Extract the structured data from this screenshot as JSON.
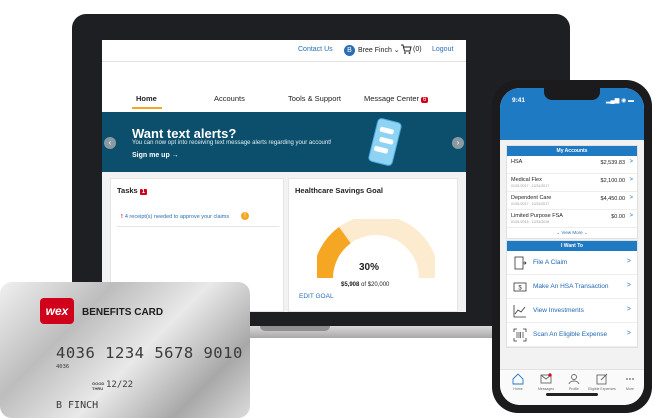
{
  "web": {
    "contact_label": "Contact Us",
    "user_initial": "B",
    "user_name": "Bree Finch ⌄",
    "cart_count": "(0)",
    "logout_label": "Logout",
    "nav": {
      "home": "Home",
      "accounts": "Accounts",
      "tools": "Tools & Support",
      "messages": "Message Center",
      "messages_badge": "6"
    },
    "banner": {
      "title": "Want text alerts?",
      "subtitle": "You can now opt into receiving text message alerts regarding your account!",
      "cta": "Sign me up →",
      "prev": "‹",
      "next": "›"
    },
    "tasks": {
      "title": "Tasks",
      "badge": "1",
      "item_warn": "!",
      "item": "4 receipt(s) needed to approve your claims",
      "item_icon": "!"
    },
    "hsa_goal": {
      "title": "Healthcare Savings Goal",
      "percent_label": "30%",
      "progress": 0.3,
      "saved": "$5,908",
      "of_total": "of $20,000",
      "edit": "EDIT GOAL"
    }
  },
  "card": {
    "logo": "wex",
    "brand": "BENEFITS CARD",
    "number": "4036 1234 5678 9010",
    "small": "4036",
    "good_thru": "GOOD THRU",
    "expiry": "12/22",
    "holder": "B FINCH"
  },
  "phone": {
    "time": "9:41",
    "status": "▂▄▆ ◉ ▬",
    "my_accounts_title": "My Accounts",
    "accounts": [
      {
        "name": "HSA",
        "dates": "",
        "value": "$2,539.83",
        "chev": ">"
      },
      {
        "name": "Medical Flex",
        "dates": "01/01/2017 - 12/31/2017",
        "value": "$2,100.00",
        "chev": ">"
      },
      {
        "name": "Dependent Care",
        "dates": "01/01/2017 - 12/31/2017",
        "value": "$4,450.00",
        "chev": ">"
      },
      {
        "name": "Limited Purpose FSA",
        "dates": "01/01/2016 - 12/31/2016",
        "value": "$0.00",
        "chev": ">"
      }
    ],
    "view_more": "View More",
    "i_want_title": "I Want To",
    "actions": [
      {
        "label": "File A Claim",
        "icon": "file-claim-icon",
        "chev": ">"
      },
      {
        "label": "Make An HSA Transaction",
        "icon": "dollar-bill-icon",
        "chev": ">"
      },
      {
        "label": "View Investments",
        "icon": "line-chart-icon",
        "chev": ">"
      },
      {
        "label": "Scan An Eligible Expense",
        "icon": "barcode-scan-icon",
        "chev": ">"
      }
    ],
    "tabs": [
      "Home",
      "Messages",
      "Profile",
      "Eligible Expenses",
      "More"
    ]
  },
  "colors": {
    "brand_blue": "#1f7ac4",
    "banner_teal": "#0b4f6c",
    "accent_orange": "#f5a623",
    "alert_red": "#d0021b"
  }
}
